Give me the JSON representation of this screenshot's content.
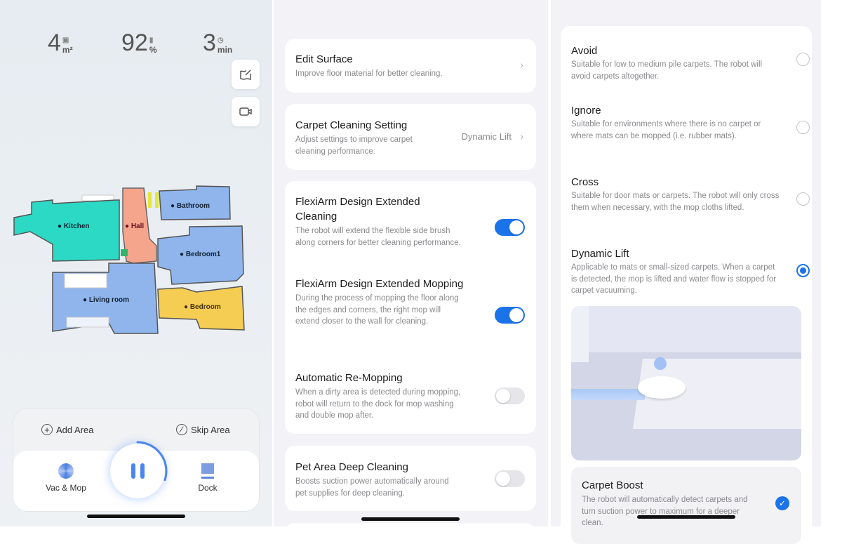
{
  "home": {
    "stats": [
      {
        "value": "4",
        "unit": "m²",
        "icon": "area-icon"
      },
      {
        "value": "92",
        "unit": "%",
        "icon": "battery-icon"
      },
      {
        "value": "3",
        "unit": "min",
        "icon": "clock-icon"
      }
    ],
    "rooms": [
      "Kitchen",
      "Hall",
      "Bathroom",
      "Bedroom1",
      "Living room",
      "Bedroom"
    ],
    "add_area": "Add Area",
    "skip_area": "Skip Area",
    "mode": "Vac & Mop",
    "dock": "Dock",
    "progress": 0.3,
    "colors": {
      "kitchen": "#2bd9c4",
      "hall": "#f4a58c",
      "blue": "#8fb5ec",
      "bedroom": "#f5cd52",
      "accent": "#4a86f0"
    }
  },
  "settings": {
    "edit_surface": {
      "title": "Edit Surface",
      "desc": "Improve floor material for better cleaning."
    },
    "carpet": {
      "title": "Carpet Cleaning Setting",
      "desc": "Adjust settings to improve carpet cleaning performance.",
      "value": "Dynamic Lift"
    },
    "toggles": [
      {
        "title": "FlexiArm Design Extended Cleaning",
        "desc": "The robot will extend the flexible side brush along corners for better cleaning performance.",
        "on": true
      },
      {
        "title": "FlexiArm Design Extended Mopping",
        "desc": "During the process of mopping the floor along the edges and corners, the right mop will extend closer to the wall for cleaning.",
        "on": true
      },
      {
        "title": "Automatic Re-Mopping",
        "desc": "When a dirty area is detected during mopping, robot will return to the dock for mop washing and double mop after.",
        "on": false
      }
    ],
    "pet": {
      "title": "Pet Area Deep Cleaning",
      "desc": "Boosts suction power automatically around pet supplies for deep cleaning.",
      "on": false
    }
  },
  "carpet_modes": {
    "options": [
      {
        "title": "Avoid",
        "desc": "Suitable for low to medium pile carpets. The robot will avoid carpets altogether.",
        "selected": false
      },
      {
        "title": "Ignore",
        "desc": "Suitable for environments where there is no carpet or where mats can be mopped (i.e. rubber mats).",
        "selected": false
      },
      {
        "title": "Cross",
        "desc": "Suitable for door mats or carpets. The robot will only cross them when necessary, with the mop cloths lifted.",
        "selected": false
      },
      {
        "title": "Dynamic Lift",
        "desc": "Applicable to mats or small-sized carpets. When a carpet is detected, the mop is lifted and water flow is stopped for carpet vacuuming.",
        "selected": true
      }
    ],
    "boost": {
      "title": "Carpet Boost",
      "desc": "The robot will automatically detect carpets and turn suction power to maximum for a deeper clean.",
      "checked": true
    }
  }
}
